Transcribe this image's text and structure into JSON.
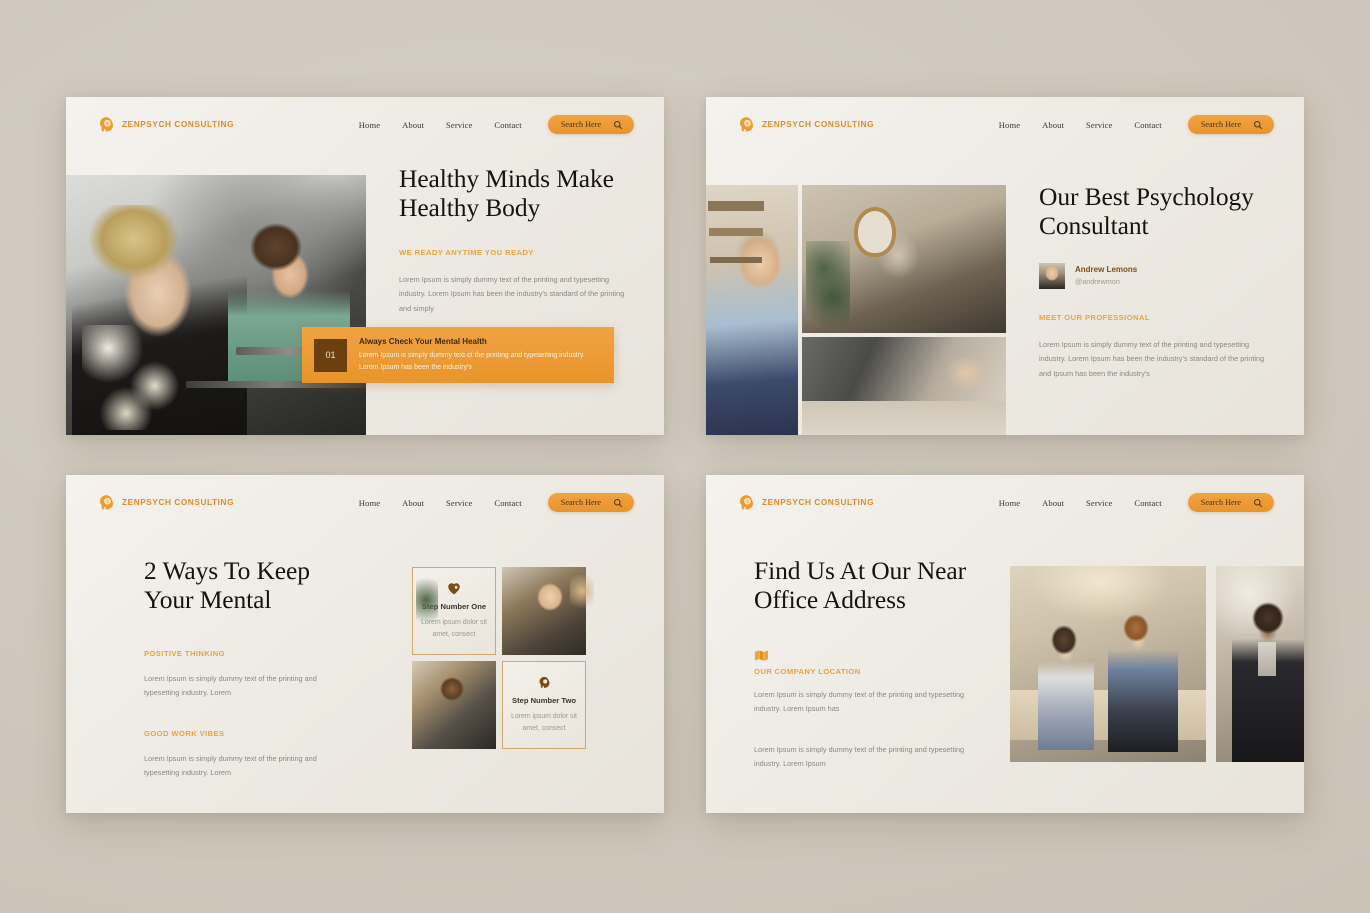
{
  "brand": {
    "name": "ZENPSYCH CONSULTING",
    "logo_icon": "head-profile-icon",
    "accent": "#e8942c",
    "accent_light": "#f0a441",
    "dark_brown": "#6b3f10"
  },
  "nav": {
    "links": [
      "Home",
      "About",
      "Service",
      "Contact"
    ],
    "search_label": "Search Here",
    "search_icon": "magnifier-icon"
  },
  "slides": [
    {
      "id": "slide-hero",
      "headline": "Healthy Minds Make Healthy Body",
      "eyebrow": "WE READY ANYTIME YOU READY",
      "paragraph": "Lorem Ipsum is simply dummy text of the printing and typesetting industry. Lorem Ipsum has been the industry's standard of the printing and simply",
      "callout": {
        "number": "01",
        "title": "Always Check Your Mental Health",
        "body": "Lorem Ipsum is simply dummy text of the printing and typesetting industry. Lorem Ipsum has been the industry's"
      },
      "photo_alt": "two-women-in-therapy-session"
    },
    {
      "id": "slide-consultant",
      "headline": "Our Best Psychology Consultant",
      "person": {
        "name": "Andrew Lemons",
        "handle": "@andrewmon"
      },
      "eyebrow": "MEET OUR PROFESSIONAL",
      "paragraph": "Lorem Ipsum is simply dummy text of the printing and typesetting industry. Lorem Ipsum has been the industry's standard of the printing and Ipsum has been the industry's",
      "gallery_alt": [
        "woman-sitting-on-floor",
        "group-therapy-living-room",
        "two-people-on-couch"
      ]
    },
    {
      "id": "slide-two-ways",
      "headline": "2 Ways To Keep Your Mental",
      "sections": [
        {
          "eyebrow": "POSITIVE THINKING",
          "paragraph": "Lorem Ipsum is simply dummy text of the printing and typesetting industry. Lorem"
        },
        {
          "eyebrow": "GOOD WORK VIBES",
          "paragraph": "Lorem Ipsum is simply dummy text of the printing and typesetting industry. Lorem"
        }
      ],
      "steps": [
        {
          "icon": "heart-icon",
          "title": "Step Number One",
          "body": "Lorem ipsum dolor sit amet, consect"
        },
        {
          "icon": "head-profile-icon",
          "title": "Step Number Two",
          "body": "Lorem ipsum dolor sit amet, consect"
        }
      ],
      "photo_alt": [
        "woman-reading-in-armchair",
        "man-sitting-by-window"
      ]
    },
    {
      "id": "slide-location",
      "headline": "Find Us At Our Near Office Address",
      "map_icon": "map-fold-icon",
      "eyebrow": "OUR COMPANY LOCATION",
      "paragraphs": [
        "Lorem Ipsum is simply dummy text of the printing and typesetting industry. Lorem Ipsum has",
        "Lorem Ipsum is simply dummy text of the printing and typesetting industry. Lorem Ipsum"
      ],
      "gallery_alt": [
        "couple-consultation-on-sofa",
        "man-in-suit-seated"
      ]
    }
  ]
}
